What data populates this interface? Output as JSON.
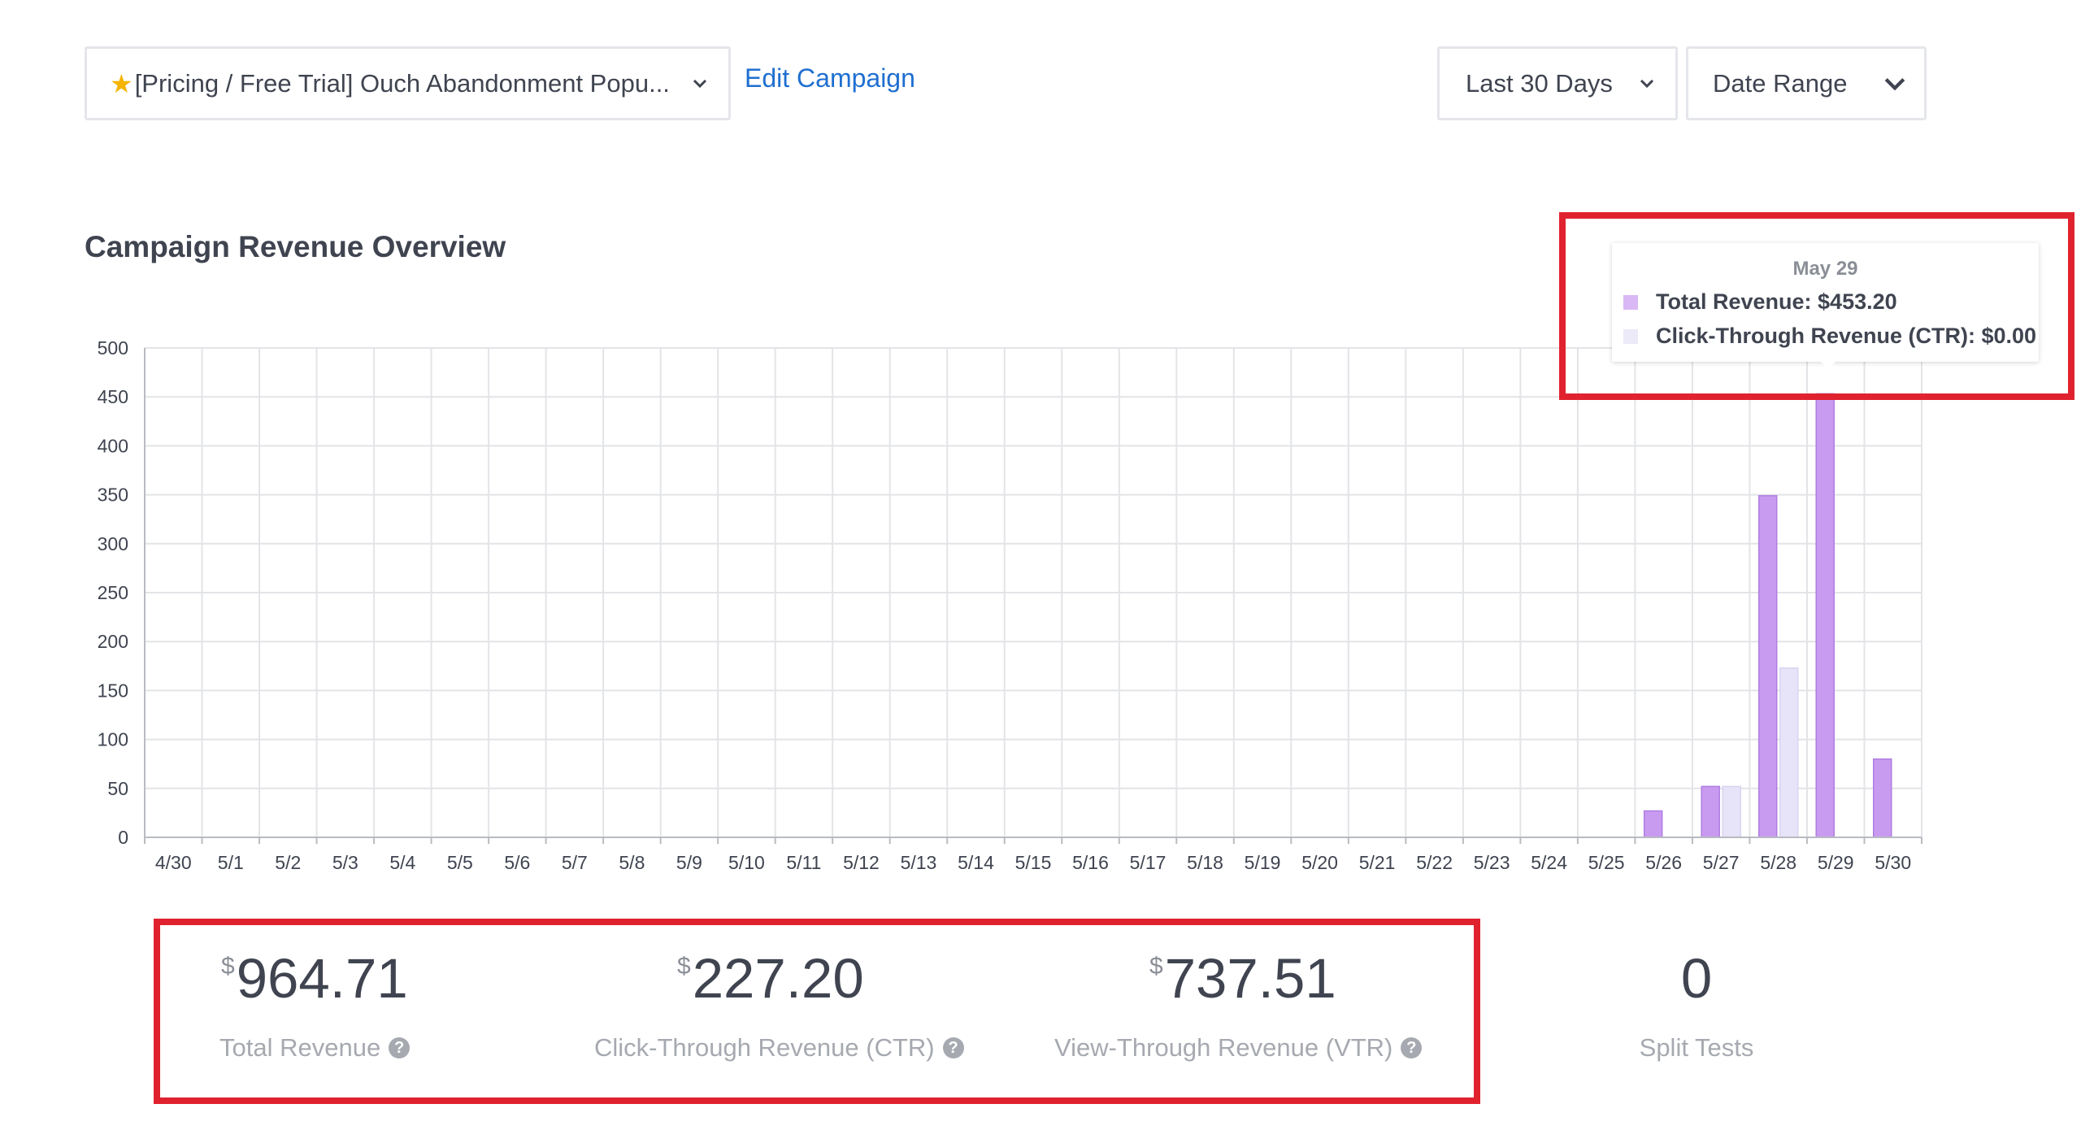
{
  "toolbar": {
    "campaign_icon": "star-icon",
    "campaign_label": "[Pricing / Free Trial] Ouch Abandonment Popu...",
    "edit_label": "Edit Campaign",
    "range_label": "Last 30 Days",
    "date_range_label": "Date Range"
  },
  "chart_title": "Campaign Revenue Overview",
  "chart_data": {
    "type": "bar",
    "categories": [
      "4/30",
      "5/1",
      "5/2",
      "5/3",
      "5/4",
      "5/5",
      "5/6",
      "5/7",
      "5/8",
      "5/9",
      "5/10",
      "5/11",
      "5/12",
      "5/13",
      "5/14",
      "5/15",
      "5/16",
      "5/17",
      "5/18",
      "5/19",
      "5/20",
      "5/21",
      "5/22",
      "5/23",
      "5/24",
      "5/25",
      "5/26",
      "5/27",
      "5/28",
      "5/29",
      "5/30"
    ],
    "series": [
      {
        "name": "Total Revenue",
        "color": "#c99bf0",
        "values": [
          0,
          0,
          0,
          0,
          0,
          0,
          0,
          0,
          0,
          0,
          0,
          0,
          0,
          0,
          0,
          0,
          0,
          0,
          0,
          0,
          0,
          0,
          0,
          0,
          0,
          0,
          27,
          52,
          349,
          453.2,
          80
        ]
      },
      {
        "name": "Click-Through Revenue (CTR)",
        "color": "#e7e3f8",
        "values": [
          0,
          0,
          0,
          0,
          0,
          0,
          0,
          0,
          0,
          0,
          0,
          0,
          0,
          0,
          0,
          0,
          0,
          0,
          0,
          0,
          0,
          0,
          0,
          0,
          0,
          0,
          0,
          52,
          173,
          0,
          0
        ]
      }
    ],
    "yticks": [
      0,
      50,
      100,
      150,
      200,
      250,
      300,
      350,
      400,
      450,
      500
    ],
    "ylim": [
      0,
      500
    ],
    "grid": true
  },
  "tooltip": {
    "date": "May 29",
    "rows": [
      {
        "label": "Total Revenue: $453.20",
        "color": "#d9b8f5"
      },
      {
        "label": "Click-Through Revenue (CTR): $0.00",
        "color": "#eceaf8"
      }
    ]
  },
  "stats": [
    {
      "currency": "$",
      "value": "964.71",
      "label": "Total Revenue",
      "help": "?"
    },
    {
      "currency": "$",
      "value": "227.20",
      "label": "Click-Through Revenue (CTR)",
      "help": "?"
    },
    {
      "currency": "$",
      "value": "737.51",
      "label": "View-Through Revenue (VTR)",
      "help": "?"
    },
    {
      "currency": "",
      "value": "0",
      "label": "Split Tests",
      "help": ""
    }
  ]
}
